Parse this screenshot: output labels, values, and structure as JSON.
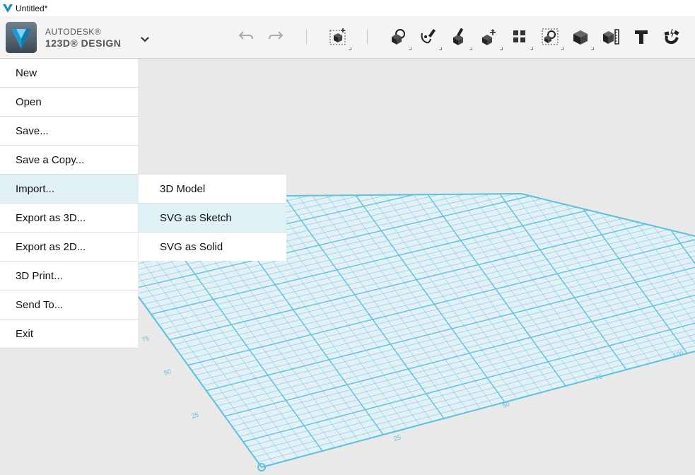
{
  "window": {
    "title": "Untitled*"
  },
  "brand": {
    "line1": "AUTODESK®",
    "line2": "123D® DESIGN"
  },
  "colors": {
    "grid": "#5cc0e0",
    "grid_fill": "#e3f1f6",
    "active_item": "#dff0f7",
    "canvas": "#e9e9e9"
  },
  "toolbar": {
    "icons": [
      "undo-icon",
      "redo-icon",
      "primitives-box-icon",
      "sketch-icon",
      "construct-icon",
      "modify-icon",
      "transform-icon",
      "pattern-icon",
      "group-icon",
      "combine-icon",
      "measure-icon",
      "text-icon",
      "snap-icon"
    ]
  },
  "menu": {
    "items": [
      {
        "label": "New"
      },
      {
        "label": "Open"
      },
      {
        "label": "Save..."
      },
      {
        "label": "Save a Copy..."
      },
      {
        "label": "Import..."
      },
      {
        "label": "Export as 3D..."
      },
      {
        "label": "Export as 2D..."
      },
      {
        "label": "3D Print..."
      },
      {
        "label": "Send To..."
      },
      {
        "label": "Exit"
      }
    ]
  },
  "submenu": {
    "items": [
      {
        "label": "3D Model"
      },
      {
        "label": "SVG as Sketch"
      },
      {
        "label": "SVG as Solid"
      }
    ]
  },
  "grid": {
    "bottom_labels": [
      "25",
      "50",
      "75",
      "100"
    ],
    "left_labels": [
      "25",
      "50",
      "75"
    ]
  }
}
